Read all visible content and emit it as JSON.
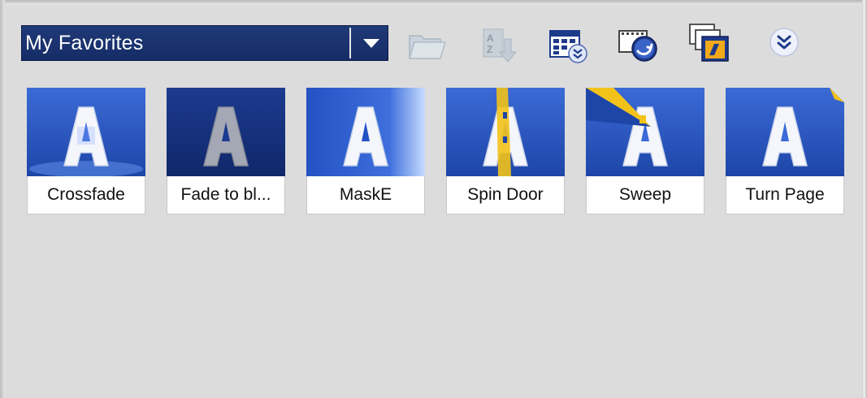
{
  "toolbar": {
    "dropdown": {
      "selected": "My Favorites"
    },
    "icons": [
      {
        "name": "open-folder-icon",
        "state": "disabled"
      },
      {
        "name": "sort-az-icon",
        "state": "disabled"
      },
      {
        "name": "view-options-icon",
        "state": "enabled"
      },
      {
        "name": "apply-transition-icon",
        "state": "enabled"
      },
      {
        "name": "stack-slides-icon",
        "state": "enabled"
      },
      {
        "name": "expand-chevron-icon",
        "state": "enabled"
      }
    ]
  },
  "transitions": [
    {
      "label": "Crossfade"
    },
    {
      "label": "Fade to bl..."
    },
    {
      "label": "MaskE"
    },
    {
      "label": "Spin Door"
    },
    {
      "label": "Sweep"
    },
    {
      "label": "Turn Page"
    }
  ],
  "colors": {
    "background": "#dcdcdc",
    "dropdown_bg": "#1b3270",
    "thumb_blue": "#2b58c8",
    "accent_yellow": "#f2c21a"
  }
}
